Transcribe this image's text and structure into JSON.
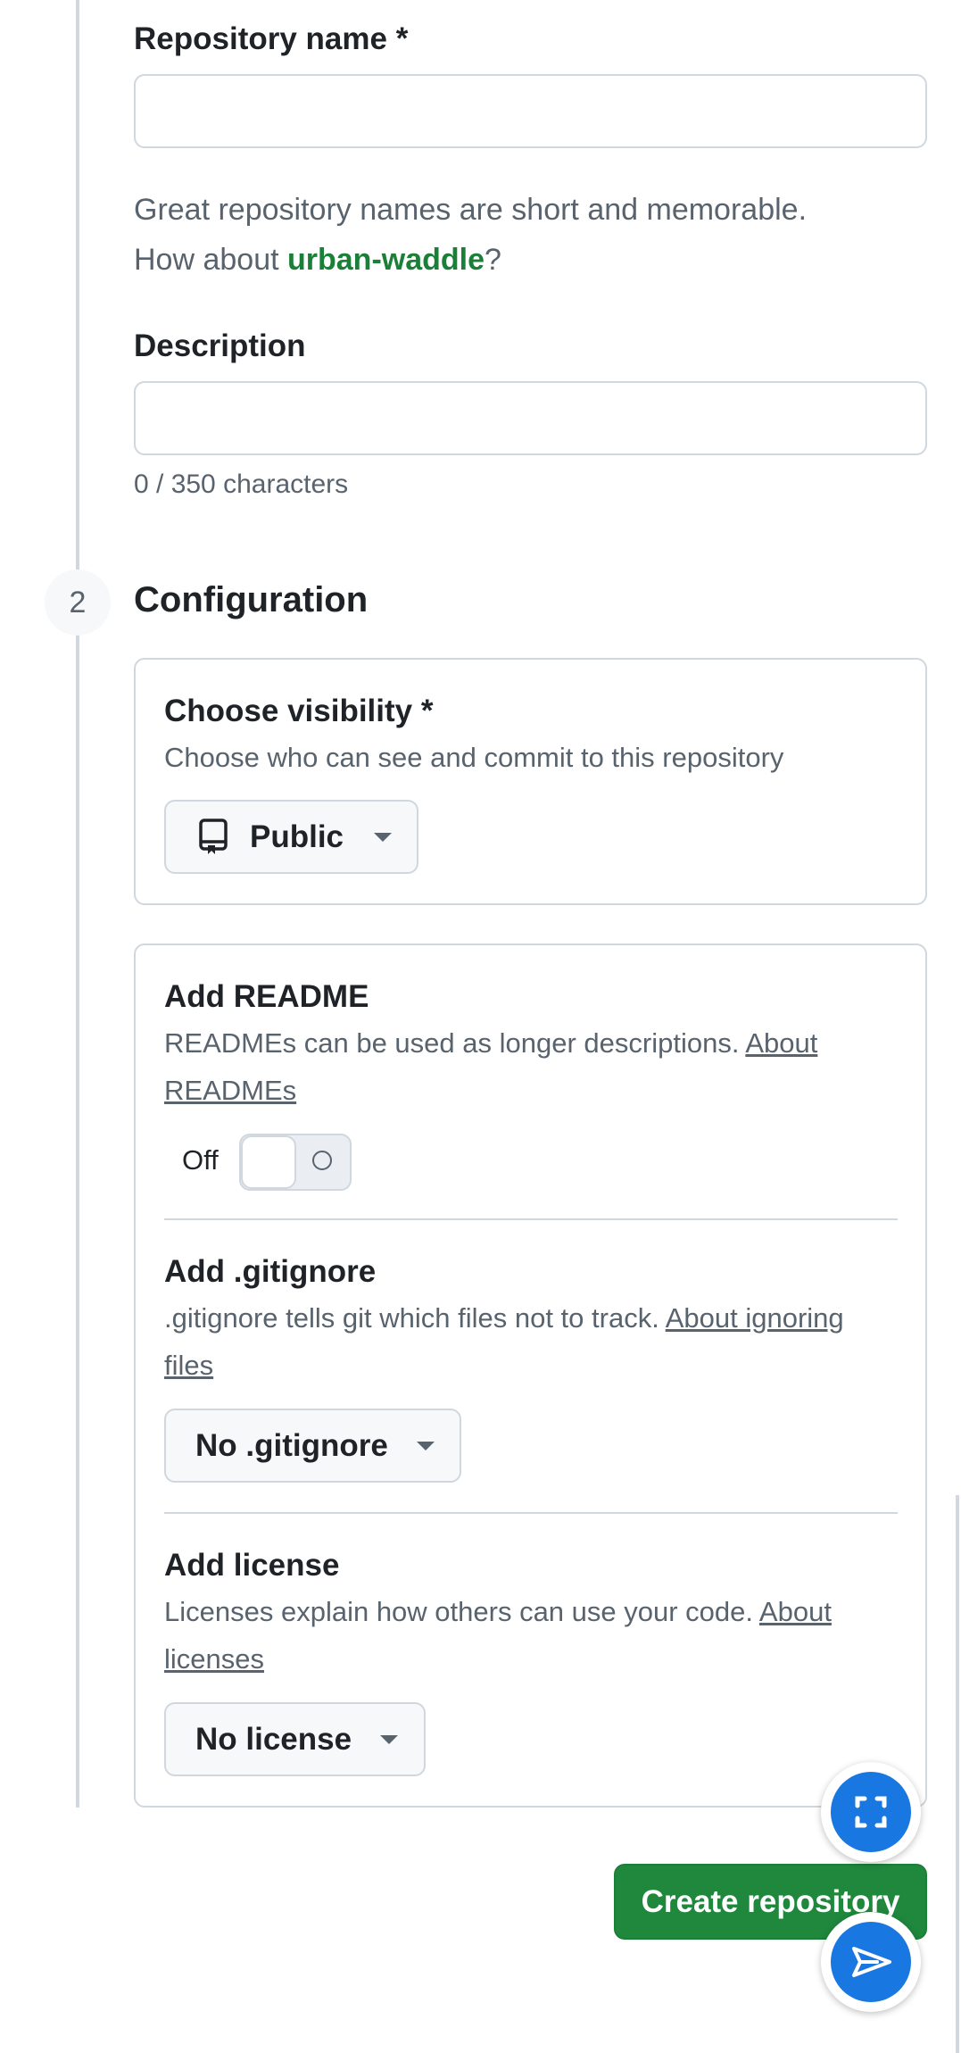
{
  "general": {
    "repo_name_label": "Repository name *",
    "repo_name_value": "",
    "hint_prefix": "Great repository names are short and memorable.",
    "hint_how_about": "How about ",
    "hint_suggestion": "urban-waddle",
    "hint_suffix": "?",
    "description_label": "Description",
    "description_value": "",
    "char_count": "0 / 350 characters"
  },
  "configuration": {
    "step_number": "2",
    "title": "Configuration",
    "visibility": {
      "title": "Choose visibility *",
      "desc": "Choose who can see and commit to this repository",
      "selected": "Public"
    },
    "readme": {
      "title": "Add README",
      "desc": "READMEs can be used as longer descriptions.",
      "link_1": "About",
      "link_2": "READMEs",
      "toggle_state": "Off"
    },
    "gitignore": {
      "title": "Add .gitignore",
      "desc": ".gitignore tells git which files not to track.",
      "link_1": "About ignoring",
      "link_2": "files",
      "selected": "No .gitignore"
    },
    "license": {
      "title": "Add license",
      "desc": "Licenses explain how others can use your code.",
      "link_1": "About",
      "link_2": "licenses",
      "selected": "No license"
    }
  },
  "actions": {
    "create_label": "Create repository"
  },
  "icons": {
    "visibility": "repo-icon",
    "fab_top": "screenshot-frame-icon",
    "fab_bottom": "send-icon"
  },
  "colors": {
    "primary_green": "#1f883d",
    "suggestion_green": "#1a7f37",
    "fab_blue": "#1877e0"
  }
}
